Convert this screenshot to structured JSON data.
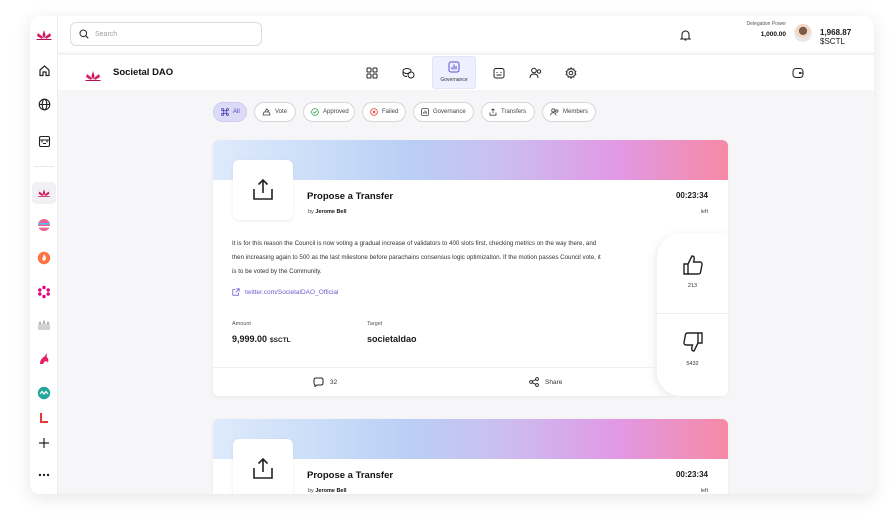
{
  "search": {
    "placeholder": "Search"
  },
  "account": {
    "delegation_label": "Delegation Power",
    "delegation_value": "1,000.00",
    "balance_amount": "1,968.87",
    "balance_unit": "$SCTL"
  },
  "brand": {
    "name": "Societal DAO"
  },
  "nav": {
    "active_label": "Governance"
  },
  "filters": [
    "All",
    "Vote",
    "Approved",
    "Failed",
    "Governance",
    "Transfers",
    "Members"
  ],
  "proposals": [
    {
      "title": "Propose a Transfer",
      "by_prefix": "by",
      "author": "Jerome Bell",
      "time": "00:23:34",
      "time_suffix": "left",
      "description": "It is for this reason the Council is now voting a gradual increase of validators to 400 slots first, checking metrics on the way there, and then increasing again to 500 as the last milestone before parachains consensus logic optimization. If the motion passes Council vote, it is to be voted by the Community.",
      "link": "twitter.com/SocietalDAO_Official",
      "amount_label": "Amount",
      "amount": "9,999.00",
      "amount_unit": "$SCTL",
      "target_label": "Target",
      "target": "societaldao",
      "upvotes": "213",
      "downvotes": "5432",
      "comments": "32",
      "share_label": "Share"
    },
    {
      "title": "Propose a Transfer",
      "by_prefix": "by",
      "author": "Jerome Bell",
      "time": "00:23:34",
      "time_suffix": "left"
    }
  ],
  "colors": {
    "accent": "#6b5fd0",
    "active_chip": "#dcdaf7",
    "brand_logo": "#c2185b"
  }
}
